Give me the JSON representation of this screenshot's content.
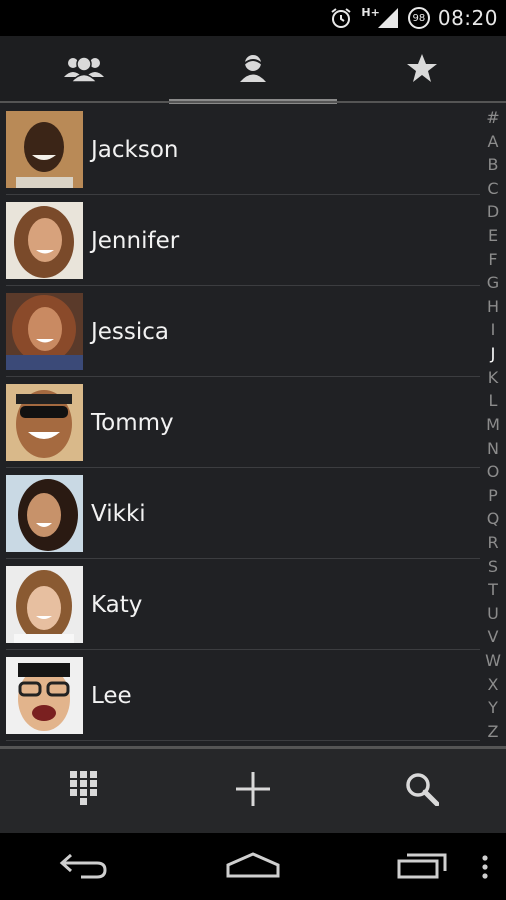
{
  "status_bar": {
    "time": "08:20",
    "battery_level": "98",
    "network_label": "H+",
    "icons": [
      "alarm-icon",
      "signal-icon",
      "battery-icon"
    ]
  },
  "tabs": [
    {
      "icon": "group-icon",
      "active": false
    },
    {
      "icon": "person-icon",
      "active": true
    },
    {
      "icon": "star-icon",
      "active": false
    }
  ],
  "contacts": [
    {
      "name": "Jackson"
    },
    {
      "name": "Jennifer"
    },
    {
      "name": "Jessica"
    },
    {
      "name": "Tommy"
    },
    {
      "name": "Vikki"
    },
    {
      "name": "Katy"
    },
    {
      "name": "Lee"
    }
  ],
  "index_letters": [
    "#",
    "A",
    "B",
    "C",
    "D",
    "E",
    "F",
    "G",
    "H",
    "I",
    "J",
    "K",
    "L",
    "M",
    "N",
    "O",
    "P",
    "Q",
    "R",
    "S",
    "T",
    "U",
    "V",
    "W",
    "X",
    "Y",
    "Z"
  ],
  "index_current": "J",
  "actions": [
    {
      "icon": "dialpad-icon"
    },
    {
      "icon": "add-icon"
    },
    {
      "icon": "search-icon"
    }
  ],
  "nav": [
    "back-icon",
    "home-icon",
    "recents-icon",
    "overflow-menu-icon"
  ]
}
